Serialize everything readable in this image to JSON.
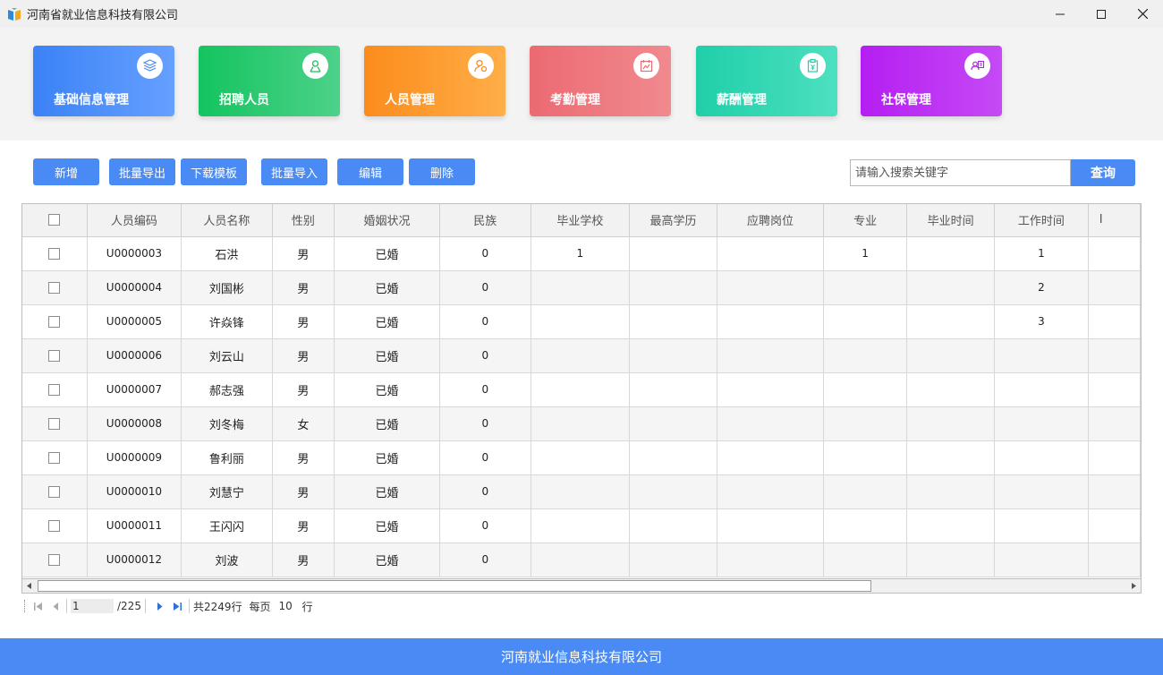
{
  "window": {
    "title": "河南省就业信息科技有限公司"
  },
  "modules": [
    {
      "label": "基础信息管理",
      "icon": "layers-icon",
      "color_from": "#3b82f6",
      "color_to": "#66a0ff"
    },
    {
      "label": "招聘人员",
      "icon": "person-recruit-icon",
      "color_from": "#14c45f",
      "color_to": "#4dd18a"
    },
    {
      "label": "人员管理",
      "icon": "person-settings-icon",
      "color_from": "#fb8c1c",
      "color_to": "#ffae48"
    },
    {
      "label": "考勤管理",
      "icon": "calendar-chart-icon",
      "color_from": "#ec6a72",
      "color_to": "#f08a8f"
    },
    {
      "label": "薪酬管理",
      "icon": "clipboard-money-icon",
      "color_from": "#1fcfa8",
      "color_to": "#4de0c0"
    },
    {
      "label": "社保管理",
      "icon": "id-card-icon",
      "color_from": "#b51ef2",
      "color_to": "#c54af5"
    }
  ],
  "toolbar": {
    "add": "新增",
    "batch_export": "批量导出",
    "download_template": "下载模板",
    "batch_import": "批量导入",
    "edit": "编辑",
    "delete": "删除",
    "search_placeholder": "请输入搜索关键字",
    "search": "查询"
  },
  "table": {
    "columns": [
      "人员编码",
      "人员名称",
      "性别",
      "婚姻状况",
      "民族",
      "毕业学校",
      "最高学历",
      "应聘岗位",
      "专业",
      "毕业时间",
      "工作时间",
      "I"
    ],
    "rows": [
      [
        "U0000003",
        "石洪",
        "男",
        "已婚",
        "0",
        "1",
        "",
        "",
        "1",
        "",
        "1",
        ""
      ],
      [
        "U0000004",
        "刘国彬",
        "男",
        "已婚",
        "0",
        "",
        "",
        "",
        "",
        "",
        "2",
        ""
      ],
      [
        "U0000005",
        "许焱锋",
        "男",
        "已婚",
        "0",
        "",
        "",
        "",
        "",
        "",
        "3",
        ""
      ],
      [
        "U0000006",
        "刘云山",
        "男",
        "已婚",
        "0",
        "",
        "",
        "",
        "",
        "",
        "",
        ""
      ],
      [
        "U0000007",
        "郝志强",
        "男",
        "已婚",
        "0",
        "",
        "",
        "",
        "",
        "",
        "",
        ""
      ],
      [
        "U0000008",
        "刘冬梅",
        "女",
        "已婚",
        "0",
        "",
        "",
        "",
        "",
        "",
        "",
        ""
      ],
      [
        "U0000009",
        "鲁利丽",
        "男",
        "已婚",
        "0",
        "",
        "",
        "",
        "",
        "",
        "",
        ""
      ],
      [
        "U0000010",
        "刘慧宁",
        "男",
        "已婚",
        "0",
        "",
        "",
        "",
        "",
        "",
        "",
        ""
      ],
      [
        "U0000011",
        "王闪闪",
        "男",
        "已婚",
        "0",
        "",
        "",
        "",
        "",
        "",
        "",
        ""
      ],
      [
        "U0000012",
        "刘波",
        "男",
        "已婚",
        "0",
        "",
        "",
        "",
        "",
        "",
        "",
        ""
      ]
    ]
  },
  "pager": {
    "current_page": "1",
    "total_pages": "/225",
    "total_rows": "共2249行",
    "per_page_label": "每页",
    "per_page": "10",
    "rows_unit": "行"
  },
  "footer": {
    "text": "河南就业信息科技有限公司"
  },
  "colors": {
    "accent": "#4a8af4"
  }
}
